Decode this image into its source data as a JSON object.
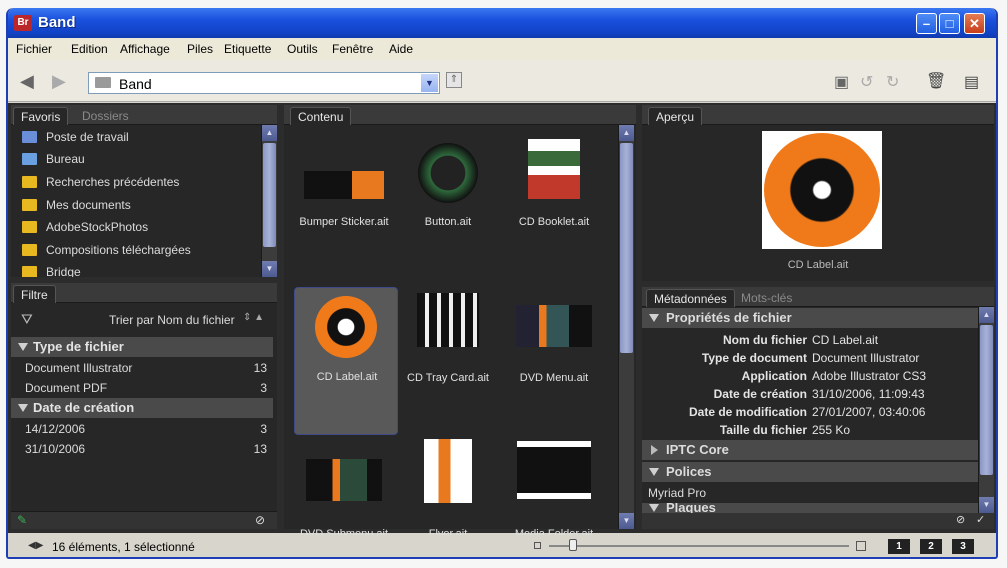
{
  "window": {
    "title": "Band",
    "app_badge": "Br"
  },
  "menu": [
    "Fichier",
    "Edition",
    "Affichage",
    "Piles",
    "Etiquette",
    "Outils",
    "Fenêtre",
    "Aide"
  ],
  "toolbar": {
    "path": "Band"
  },
  "left_panel": {
    "tabs": [
      "Favoris",
      "Dossiers"
    ],
    "favorites": [
      "Poste de travail",
      "Bureau",
      "Recherches précédentes",
      "Mes documents",
      "AdobeStockPhotos",
      "Compositions téléchargées",
      "Bridge"
    ]
  },
  "filter_panel": {
    "tab": "Filtre",
    "sort_label": "Trier par Nom du fichier",
    "groups": [
      {
        "name": "Type de fichier",
        "items": [
          {
            "label": "Document Illustrator",
            "count": "13"
          },
          {
            "label": "Document PDF",
            "count": "3"
          }
        ]
      },
      {
        "name": "Date de création",
        "items": [
          {
            "label": "14/12/2006",
            "count": "3"
          },
          {
            "label": "31/10/2006",
            "count": "13"
          }
        ]
      }
    ]
  },
  "content": {
    "tab": "Contenu",
    "thumbnails": [
      "Bumper Sticker.ait",
      "Button.ait",
      "CD Booklet.ait",
      "CD Label.ait",
      "CD Tray Card.ait",
      "DVD Menu.ait",
      "DVD Submenu.ait",
      "Flyer.ait",
      "Media Folder.ait"
    ],
    "selected": "CD Label.ait"
  },
  "preview": {
    "tab": "Aperçu",
    "caption": "CD Label.ait"
  },
  "metadata": {
    "tabs": [
      "Métadonnées",
      "Mots-clés"
    ],
    "section_file": "Propriétés de fichier",
    "rows": [
      {
        "key": "Nom du fichier",
        "value": "CD Label.ait"
      },
      {
        "key": "Type de document",
        "value": "Document Illustrator"
      },
      {
        "key": "Application",
        "value": "Adobe Illustrator CS3"
      },
      {
        "key": "Date de création",
        "value": "31/10/2006, 11:09:43"
      },
      {
        "key": "Date de modification",
        "value": "27/01/2007, 03:40:06"
      },
      {
        "key": "Taille du fichier",
        "value": "255 Ko"
      }
    ],
    "section_iptc": "IPTC Core",
    "section_fonts": "Polices",
    "font": "Myriad Pro",
    "section_plates": "Plaques"
  },
  "status": {
    "text": "16 éléments, 1 sélectionné",
    "view_buttons": [
      "1",
      "2",
      "3"
    ]
  },
  "colors": {
    "accent": "#1f52de",
    "selection": "#5a5a5a",
    "panel": "#272727"
  }
}
